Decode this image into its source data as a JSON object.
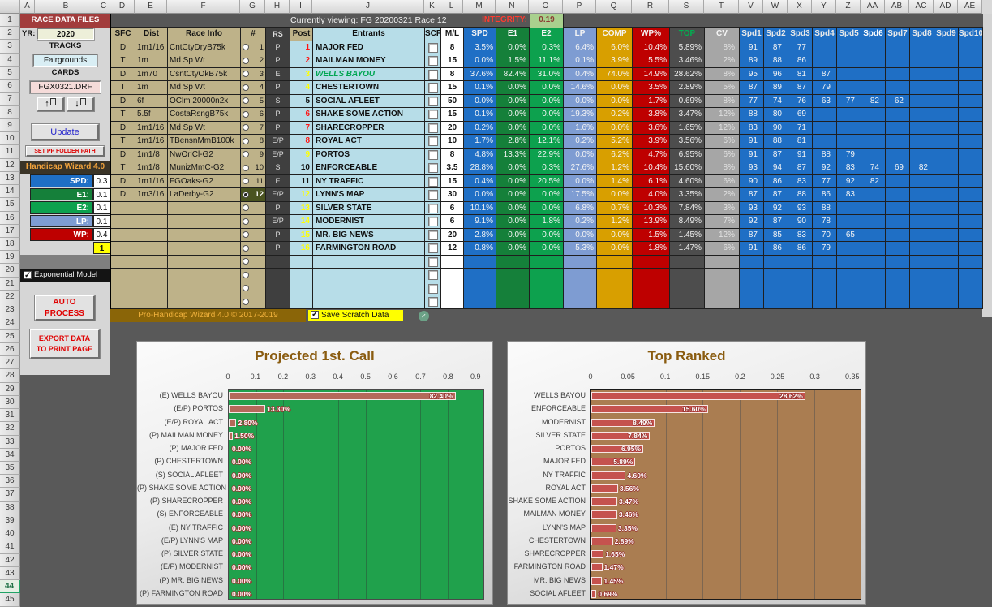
{
  "columns": {
    "letters": [
      "A",
      "B",
      "C",
      "D",
      "E",
      "F",
      "G",
      "H",
      "I",
      "J",
      "K",
      "L",
      "M",
      "N",
      "O",
      "P",
      "Q",
      "R",
      "S",
      "T",
      "V",
      "W",
      "X",
      "Y",
      "Z",
      "AA",
      "AB",
      "AC",
      "AD",
      "AE"
    ],
    "widths": [
      18,
      77,
      16,
      30,
      40,
      90,
      31,
      30,
      28,
      138,
      20,
      28,
      40,
      41,
      42,
      41,
      44,
      46,
      43,
      43,
      30,
      30,
      30,
      30,
      30,
      30,
      30,
      30,
      30,
      30
    ]
  },
  "rows_total": 45,
  "active_row": 44,
  "left_panel": {
    "title": "RACE DATA FILES",
    "yr_label": "YR:",
    "yr_value": "2020",
    "tracks_label": "TRACKS",
    "track_value": "Fairgrounds",
    "cards_label": "CARDS",
    "card_value": "FGX0321.DRF",
    "up_label": "↑",
    "down_label": "↓",
    "update_label": "Update",
    "set_path_label": "SET PP FOLDER PATH",
    "wizard_title": "Handicap Wizard 4.0",
    "weights": [
      {
        "label": "SPD:",
        "value": "0.3",
        "color": "#1F6FC5"
      },
      {
        "label": "E1:",
        "value": "0.1",
        "color": "#15803A"
      },
      {
        "label": "E2:",
        "value": "0.1",
        "color": "#0DA14E"
      },
      {
        "label": "LP:",
        "value": "0.1",
        "color": "#7E9CD2"
      },
      {
        "label": "WP:",
        "value": "0.4",
        "color": "#BE0000"
      }
    ],
    "weights_sum": "1",
    "exponential_label": "Exponential Model",
    "exponential_checked": true,
    "auto_process_label": "AUTO PROCESS",
    "export_label": "EXPORT DATA TO PRINT PAGE"
  },
  "banner": {
    "viewing_text": "Currently viewing: FG 20200321 Race 12",
    "integrity_label": "INTEGRITY:",
    "integrity_value": "0.19"
  },
  "table": {
    "headers": {
      "sfc": "SFC",
      "dist": "Dist",
      "race_info": "Race Info",
      "num": "#",
      "rs": "RS",
      "post": "Post",
      "entrants": "Entrants",
      "scr": "SCR",
      "ml": "M/L",
      "spd": "SPD",
      "e1": "E1",
      "e2": "E2",
      "lp": "LP",
      "comp": "COMP",
      "wp": "WP%",
      "top": "TOP",
      "cv": "CV",
      "spd_cols": [
        "Spd1",
        "Spd2",
        "Spd3",
        "Spd4",
        "Spd5",
        "Spd6",
        "Spd7",
        "Spd8",
        "Spd9",
        "Spd10"
      ]
    },
    "races": [
      {
        "sfc": "D",
        "dist": "1m1/16",
        "info": "CntCtyDryB75k",
        "num": "1"
      },
      {
        "sfc": "T",
        "dist": "1m",
        "info": "Md Sp Wt",
        "num": "2"
      },
      {
        "sfc": "D",
        "dist": "1m70",
        "info": "CsntCtyOkB75k",
        "num": "3"
      },
      {
        "sfc": "T",
        "dist": "1m",
        "info": "Md Sp Wt",
        "num": "4"
      },
      {
        "sfc": "D",
        "dist": "6f",
        "info": "OClm 20000n2x",
        "num": "5"
      },
      {
        "sfc": "T",
        "dist": "5.5f",
        "info": "CostaRsngB75k",
        "num": "6"
      },
      {
        "sfc": "D",
        "dist": "1m1/16",
        "info": "Md Sp Wt",
        "num": "7"
      },
      {
        "sfc": "T",
        "dist": "1m1/16",
        "info": "TBensnMmB100k",
        "num": "8"
      },
      {
        "sfc": "D",
        "dist": "1m1/8",
        "info": "NwOrlCl-G2",
        "num": "9"
      },
      {
        "sfc": "T",
        "dist": "1m1/8",
        "info": "MunizMmC-G2",
        "num": "10"
      },
      {
        "sfc": "D",
        "dist": "1m1/16",
        "info": "FGOaks-G2",
        "num": "11"
      },
      {
        "sfc": "D",
        "dist": "1m3/16",
        "info": "LaDerby-G2",
        "num": "12",
        "selected": true
      }
    ],
    "entries": [
      {
        "rs": "P",
        "post": "1",
        "post_color": "red",
        "name": "MAJOR FED",
        "ml": "8",
        "spd": "3.5%",
        "e1": "0.0%",
        "e2": "0.3%",
        "lp": "6.4%",
        "comp": "6.0%",
        "wp": "10.4%",
        "top": "5.89%",
        "cv": "8%",
        "spds": [
          "91",
          "87",
          "77"
        ]
      },
      {
        "rs": "P",
        "post": "2",
        "post_color": "red",
        "name": "MAILMAN MONEY",
        "ml": "15",
        "spd": "0.0%",
        "e1": "1.5%",
        "e2": "11.1%",
        "lp": "0.1%",
        "comp": "3.9%",
        "wp": "5.5%",
        "top": "3.46%",
        "cv": "2%",
        "spds": [
          "89",
          "88",
          "86"
        ]
      },
      {
        "rs": "E",
        "post": "3",
        "post_color": "yellow",
        "name": "WELLS BAYOU",
        "highlight": true,
        "ml": "8",
        "spd": "37.6%",
        "e1": "82.4%",
        "e2": "31.0%",
        "lp": "0.4%",
        "comp": "74.0%",
        "wp": "14.9%",
        "top": "28.62%",
        "cv": "8%",
        "spds": [
          "95",
          "96",
          "81",
          "87"
        ]
      },
      {
        "rs": "P",
        "post": "4",
        "post_color": "yellow",
        "name": "CHESTERTOWN",
        "ml": "15",
        "spd": "0.1%",
        "e1": "0.0%",
        "e2": "0.0%",
        "lp": "14.6%",
        "comp": "0.0%",
        "wp": "3.5%",
        "top": "2.89%",
        "cv": "5%",
        "spds": [
          "87",
          "89",
          "87",
          "79"
        ]
      },
      {
        "rs": "S",
        "post": "5",
        "post_color": "black",
        "name": "SOCIAL AFLEET",
        "ml": "50",
        "spd": "0.0%",
        "e1": "0.0%",
        "e2": "0.0%",
        "lp": "0.0%",
        "comp": "0.0%",
        "wp": "1.7%",
        "top": "0.69%",
        "cv": "8%",
        "spds": [
          "77",
          "74",
          "76",
          "63",
          "77",
          "82",
          "62"
        ]
      },
      {
        "rs": "P",
        "post": "6",
        "post_color": "red",
        "name": "SHAKE SOME ACTION",
        "ml": "15",
        "spd": "0.1%",
        "e1": "0.0%",
        "e2": "0.0%",
        "lp": "19.3%",
        "comp": "0.2%",
        "wp": "3.8%",
        "top": "3.47%",
        "cv": "12%",
        "spds": [
          "88",
          "80",
          "69"
        ]
      },
      {
        "rs": "P",
        "post": "7",
        "post_color": "red",
        "name": "SHARECROPPER",
        "ml": "20",
        "spd": "0.2%",
        "e1": "0.0%",
        "e2": "0.0%",
        "lp": "1.6%",
        "comp": "0.0%",
        "wp": "3.6%",
        "top": "1.65%",
        "cv": "12%",
        "spds": [
          "83",
          "90",
          "71"
        ]
      },
      {
        "rs": "E/P",
        "post": "8",
        "post_color": "red",
        "name": "ROYAL ACT",
        "ml": "10",
        "spd": "1.7%",
        "e1": "2.8%",
        "e2": "12.1%",
        "lp": "0.2%",
        "comp": "5.2%",
        "wp": "3.9%",
        "top": "3.56%",
        "cv": "6%",
        "spds": [
          "91",
          "88",
          "81"
        ]
      },
      {
        "rs": "E/P",
        "post": "9",
        "post_color": "yellow",
        "name": "PORTOS",
        "ml": "8",
        "spd": "4.8%",
        "e1": "13.3%",
        "e2": "22.9%",
        "lp": "0.0%",
        "comp": "6.2%",
        "wp": "4.7%",
        "top": "6.95%",
        "cv": "6%",
        "spds": [
          "91",
          "87",
          "91",
          "88",
          "79"
        ]
      },
      {
        "rs": "S",
        "post": "10",
        "post_color": "black",
        "name": "ENFORCEABLE",
        "ml": "3.5",
        "spd": "28.8%",
        "e1": "0.0%",
        "e2": "0.3%",
        "lp": "27.6%",
        "comp": "1.2%",
        "wp": "10.4%",
        "top": "15.60%",
        "cv": "8%",
        "spds": [
          "93",
          "94",
          "87",
          "92",
          "83",
          "74",
          "69",
          "82"
        ]
      },
      {
        "rs": "E",
        "post": "11",
        "post_color": "black",
        "name": "NY TRAFFIC",
        "ml": "15",
        "spd": "0.4%",
        "e1": "0.0%",
        "e2": "20.5%",
        "lp": "0.0%",
        "comp": "1.4%",
        "wp": "6.1%",
        "top": "4.60%",
        "cv": "6%",
        "spds": [
          "90",
          "86",
          "83",
          "77",
          "92",
          "82"
        ]
      },
      {
        "rs": "E/P",
        "post": "12",
        "post_color": "yellow",
        "name": "LYNN'S MAP",
        "ml": "30",
        "spd": "0.0%",
        "e1": "0.0%",
        "e2": "0.0%",
        "lp": "17.5%",
        "comp": "0.0%",
        "wp": "4.0%",
        "top": "3.35%",
        "cv": "2%",
        "spds": [
          "87",
          "87",
          "88",
          "86",
          "83"
        ]
      },
      {
        "rs": "P",
        "post": "13",
        "post_color": "yellow",
        "name": "SILVER STATE",
        "ml": "6",
        "spd": "10.1%",
        "e1": "0.0%",
        "e2": "0.0%",
        "lp": "6.8%",
        "comp": "0.7%",
        "wp": "10.3%",
        "top": "7.84%",
        "cv": "3%",
        "spds": [
          "93",
          "92",
          "93",
          "88"
        ]
      },
      {
        "rs": "E/P",
        "post": "14",
        "post_color": "yellow",
        "name": "MODERNIST",
        "ml": "6",
        "spd": "9.1%",
        "e1": "0.0%",
        "e2": "1.8%",
        "lp": "0.2%",
        "comp": "1.2%",
        "wp": "13.9%",
        "top": "8.49%",
        "cv": "7%",
        "spds": [
          "92",
          "87",
          "90",
          "78"
        ]
      },
      {
        "rs": "P",
        "post": "15",
        "post_color": "yellow",
        "name": "MR. BIG NEWS",
        "ml": "20",
        "spd": "2.8%",
        "e1": "0.0%",
        "e2": "0.0%",
        "lp": "0.0%",
        "comp": "0.0%",
        "wp": "1.5%",
        "top": "1.45%",
        "cv": "12%",
        "spds": [
          "87",
          "85",
          "83",
          "70",
          "65"
        ]
      },
      {
        "rs": "P",
        "post": "16",
        "post_color": "yellow",
        "name": "FARMINGTON ROAD",
        "ml": "12",
        "spd": "0.8%",
        "e1": "0.0%",
        "e2": "0.0%",
        "lp": "5.3%",
        "comp": "0.0%",
        "wp": "1.8%",
        "top": "1.47%",
        "cv": "6%",
        "spds": [
          "91",
          "86",
          "86",
          "79"
        ]
      }
    ],
    "empty_rows": 4,
    "footer": {
      "brand": "Pro-Handicap Wizard 4.0 © 2017-2019",
      "save_scratch_label": "Save Scratch Data",
      "save_scratch_checked": true
    }
  },
  "chart_data": [
    {
      "type": "bar",
      "orientation": "horizontal",
      "title": "Projected 1st. Call",
      "categories": [
        "(E) WELLS BAYOU",
        "(E/P) PORTOS",
        "(E/P) ROYAL ACT",
        "(P) MAILMAN MONEY",
        "(P) MAJOR FED",
        "(P) CHESTERTOWN",
        "(S) SOCIAL AFLEET",
        "(P) SHAKE SOME ACTION",
        "(P) SHARECROPPER",
        "(S) ENFORCEABLE",
        "(E) NY TRAFFIC",
        "(E/P) LYNN'S MAP",
        "(P) SILVER STATE",
        "(E/P) MODERNIST",
        "(P) MR. BIG NEWS",
        "(P) FARMINGTON ROAD"
      ],
      "values": [
        0.824,
        0.133,
        0.028,
        0.015,
        0,
        0,
        0,
        0,
        0,
        0,
        0,
        0,
        0,
        0,
        0,
        0
      ],
      "labels": [
        "82.40%",
        "13.30%",
        "2.80%",
        "1.50%",
        "0.00%",
        "0.00%",
        "0.00%",
        "0.00%",
        "0.00%",
        "0.00%",
        "0.00%",
        "0.00%",
        "0.00%",
        "0.00%",
        "0.00%",
        "0.00%"
      ],
      "xlim": [
        0,
        0.9
      ],
      "xticks": [
        "0",
        "0.1",
        "0.2",
        "0.3",
        "0.4",
        "0.5",
        "0.6",
        "0.7",
        "0.8",
        "0.9"
      ],
      "grid": true,
      "legend": false,
      "plot_bg": "#20A14C",
      "bar_color": "#B4695A",
      "grid_color": "rgba(50,50,50,0.38)",
      "border_color": "#4a4a4a"
    },
    {
      "type": "bar",
      "orientation": "horizontal",
      "title": "Top Ranked",
      "categories": [
        "WELLS BAYOU",
        "ENFORCEABLE",
        "MODERNIST",
        "SILVER STATE",
        "PORTOS",
        "MAJOR FED",
        "NY TRAFFIC",
        "ROYAL ACT",
        "SHAKE SOME ACTION",
        "MAILMAN MONEY",
        "LYNN'S MAP",
        "CHESTERTOWN",
        "SHARECROPPER",
        "FARMINGTON ROAD",
        "MR. BIG NEWS",
        "SOCIAL AFLEET"
      ],
      "values": [
        0.2862,
        0.156,
        0.0849,
        0.0784,
        0.0695,
        0.0589,
        0.046,
        0.0356,
        0.0347,
        0.0346,
        0.0335,
        0.0289,
        0.0165,
        0.0147,
        0.0145,
        0.0069
      ],
      "labels": [
        "28.62%",
        "15.60%",
        "8.49%",
        "7.84%",
        "6.95%",
        "5.89%",
        "4.60%",
        "3.56%",
        "3.47%",
        "3.46%",
        "3.35%",
        "2.89%",
        "1.65%",
        "1.47%",
        "1.45%",
        "0.69%"
      ],
      "xlim": [
        0,
        0.35
      ],
      "xticks": [
        "0",
        "0.05",
        "0.1",
        "0.15",
        "0.2",
        "0.25",
        "0.3",
        "0.35"
      ],
      "grid": true,
      "legend": false,
      "plot_bg": "#AA7D51",
      "bar_color": "#C5524E",
      "grid_color": "rgba(80,80,80,0.5)",
      "border_color": "#1a1a1a"
    }
  ]
}
